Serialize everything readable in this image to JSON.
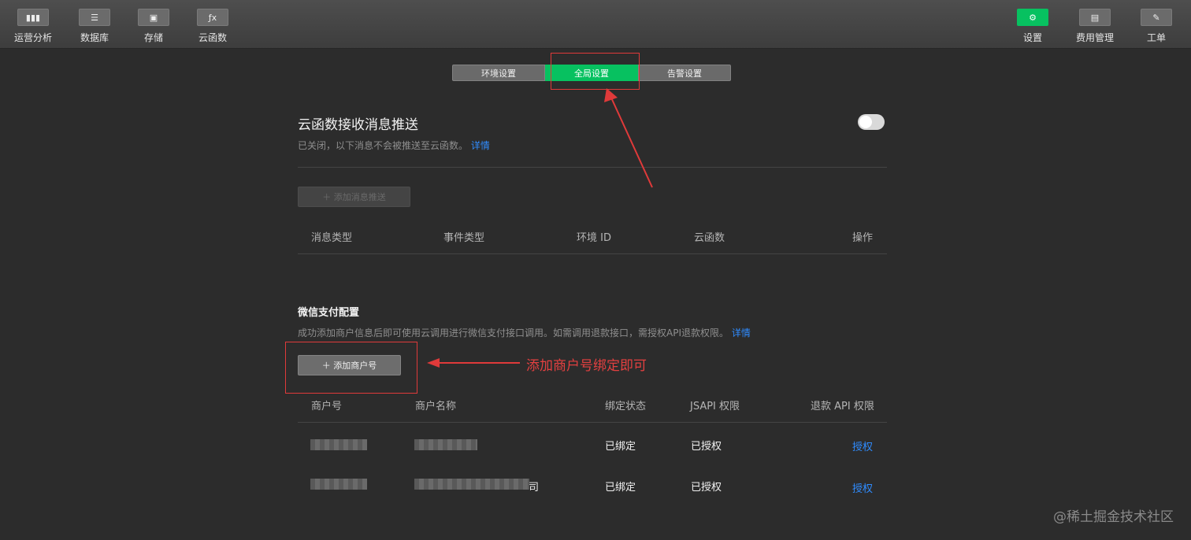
{
  "toolbar": {
    "left": [
      {
        "label": "运营分析",
        "icon": "bar-chart-icon"
      },
      {
        "label": "数据库",
        "icon": "database-icon"
      },
      {
        "label": "存储",
        "icon": "save-icon"
      },
      {
        "label": "云函数",
        "icon": "function-icon"
      }
    ],
    "right": [
      {
        "label": "设置",
        "icon": "gear-icon",
        "active": true
      },
      {
        "label": "费用管理",
        "icon": "billing-icon"
      },
      {
        "label": "工单",
        "icon": "ticket-icon"
      }
    ]
  },
  "tabs": [
    {
      "label": "环境设置"
    },
    {
      "label": "全局设置",
      "active": true
    },
    {
      "label": "告警设置"
    }
  ],
  "push": {
    "title": "云函数接收消息推送",
    "desc": "已关闭，以下消息不会被推送至云函数。",
    "detail_link": "详情",
    "toggle_on": false,
    "add_button": "添加消息推送",
    "columns": [
      "消息类型",
      "事件类型",
      "环境 ID",
      "云函数",
      "操作"
    ]
  },
  "wxpay": {
    "title": "微信支付配置",
    "desc": "成功添加商户信息后即可使用云调用进行微信支付接口调用。如需调用退款接口，需授权API退款权限。",
    "detail_link": "详情",
    "add_button": "添加商户号",
    "columns": [
      "商户号",
      "商户名称",
      "绑定状态",
      "JSAPI 权限",
      "退款 API 权限"
    ],
    "rows": [
      {
        "name_suffix": "",
        "status": "已绑定",
        "jsapi": "已授权",
        "refund": "授权"
      },
      {
        "name_suffix": "司",
        "status": "已绑定",
        "jsapi": "已授权",
        "refund": "授权"
      }
    ]
  },
  "annotation": "添加商户号绑定即可",
  "watermark": "@稀土掘金技术社区",
  "colors": {
    "accent": "#07c160",
    "link": "#2f8cff",
    "annotation": "#e03a3a"
  }
}
